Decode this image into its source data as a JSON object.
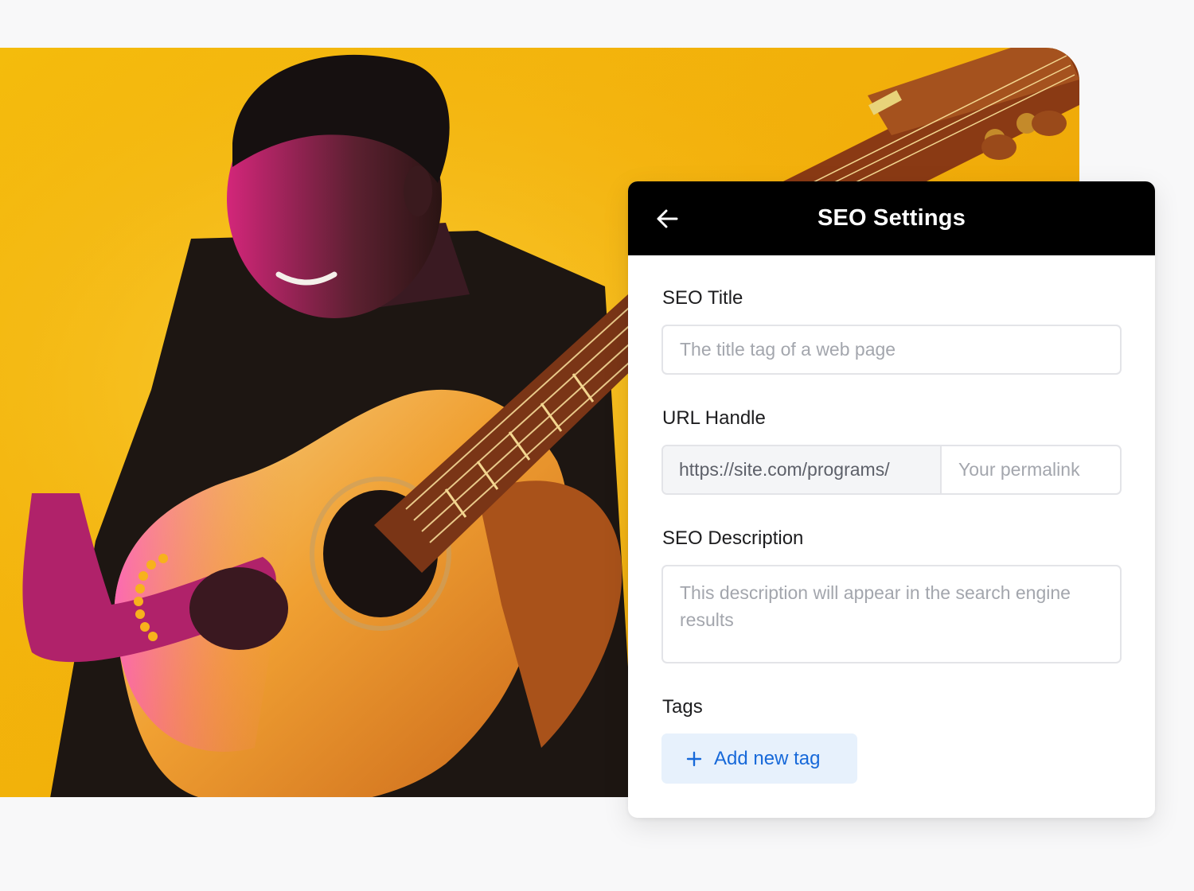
{
  "hero": {
    "background_color": "#f4bd0c"
  },
  "seo_panel": {
    "title": "SEO Settings",
    "back_icon": "arrow-left-icon",
    "fields": {
      "seo_title": {
        "label": "SEO Title",
        "placeholder": "The title tag of a web page"
      },
      "url_handle": {
        "label": "URL Handle",
        "prefix": "https://site.com/programs/",
        "placeholder": "Your permalink"
      },
      "seo_description": {
        "label": "SEO Description",
        "placeholder": "This description will appear in the search engine results"
      },
      "tags": {
        "label": "Tags",
        "add_button_label": "Add new tag",
        "add_button_icon": "plus-icon"
      }
    },
    "colors": {
      "header_bg": "#000000",
      "accent": "#1769d9",
      "tag_button_bg": "#e7f1fc"
    }
  }
}
